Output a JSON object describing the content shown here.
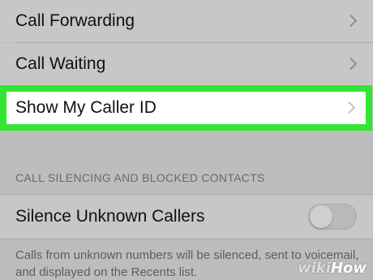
{
  "settings": {
    "rows": [
      {
        "label": "Call Forwarding",
        "icon": "chevron-right-icon"
      },
      {
        "label": "Call Waiting",
        "icon": "chevron-right-icon"
      },
      {
        "label": "Show My Caller ID",
        "icon": "chevron-right-icon",
        "highlight_color": "#33e633"
      }
    ],
    "section_header": "CALL SILENCING AND BLOCKED CONTACTS",
    "silence_unknown": {
      "label": "Silence Unknown Callers",
      "toggle_on": false
    },
    "footer": "Calls from unknown numbers will be silenced, sent to voicemail, and displayed on the Recents list."
  },
  "watermark": {
    "wiki": "wiki",
    "how": "How"
  },
  "colors": {
    "highlight": "#33e633",
    "background": "#bdbdbd"
  }
}
